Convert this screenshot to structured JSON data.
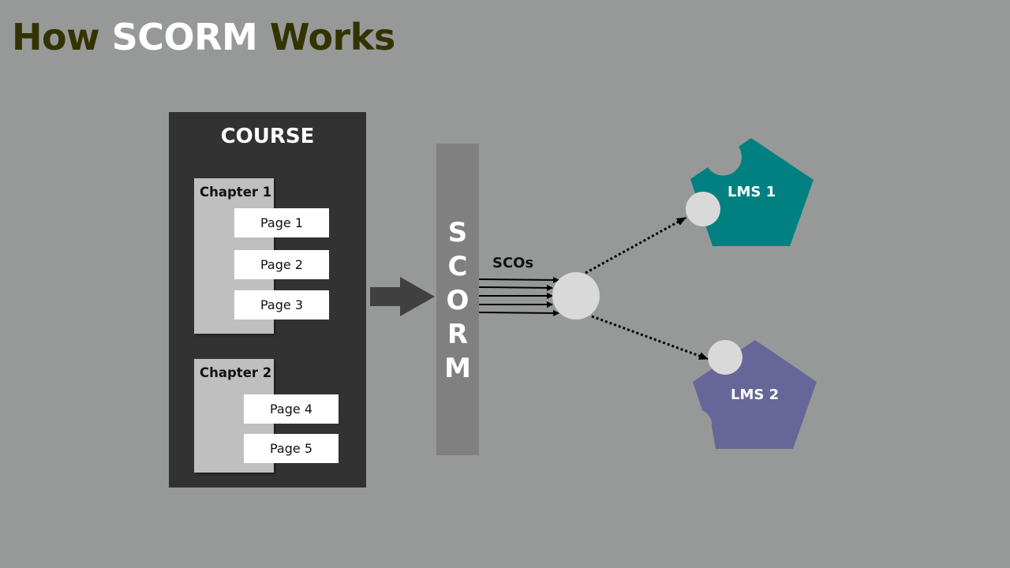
{
  "title": {
    "prefix": "How ",
    "highlight": "SCORM",
    "suffix": " Works"
  },
  "course": {
    "label": "COURSE",
    "chapters": [
      {
        "label": "Chapter 1",
        "pages": [
          "Page 1",
          "Page 2",
          "Page 3"
        ]
      },
      {
        "label": "Chapter 2",
        "pages": [
          "Page 4",
          "Page 5"
        ]
      }
    ]
  },
  "scorm": {
    "letters": [
      "S",
      "C",
      "O",
      "R",
      "M"
    ]
  },
  "scos_label": "SCOs",
  "lms": [
    {
      "label": "LMS 1",
      "color": "#008080"
    },
    {
      "label": "LMS 2",
      "color": "#666699"
    }
  ],
  "colors": {
    "background": "#979998",
    "course_bg": "#323232",
    "chapter_bg": "#bfbfbf",
    "scorm_bar": "#808080",
    "hub": "#d9d9d9",
    "title_dark": "#333300"
  }
}
